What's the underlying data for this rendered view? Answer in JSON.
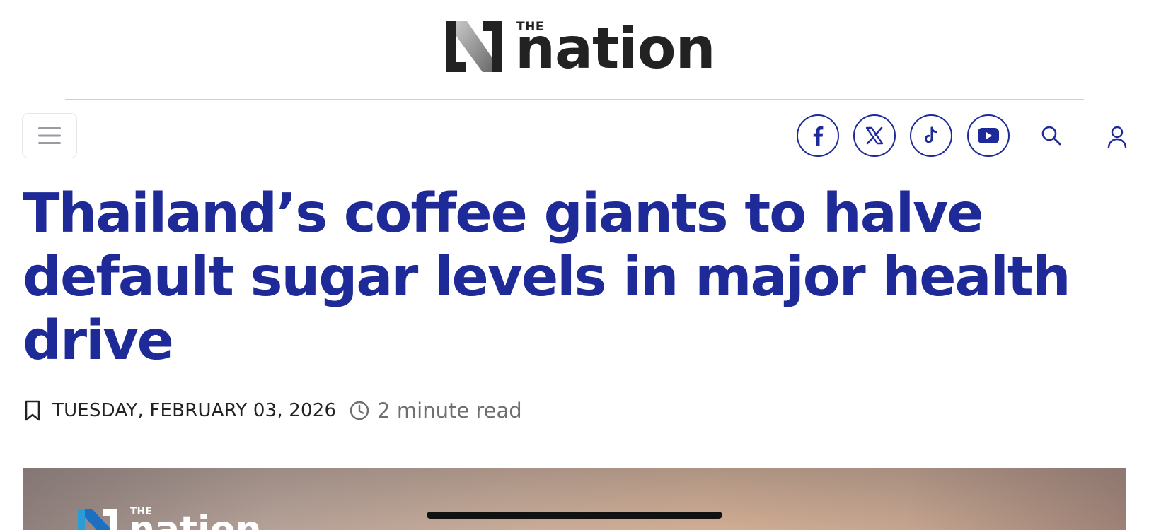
{
  "header": {
    "logo_small": "THE",
    "logo_word": "nation"
  },
  "nav": {
    "menu_icon": "hamburger-menu-icon",
    "social": [
      {
        "icon": "facebook-icon"
      },
      {
        "icon": "x-icon"
      },
      {
        "icon": "tiktok-icon"
      },
      {
        "icon": "youtube-icon"
      }
    ],
    "search_icon": "search-icon",
    "user_icon": "user-icon"
  },
  "article": {
    "title": "Thailand’s coffee giants to halve default sugar levels in major health drive",
    "date": "TUESDAY, FEBRUARY 03, 2026",
    "read_time": "2 minute read"
  },
  "hero_image": {
    "watermark_small": "THE",
    "watermark_word": "nation"
  },
  "colors": {
    "brand_blue": "#1f2a99",
    "text_dark": "#222222",
    "text_muted": "#6f6f72"
  }
}
